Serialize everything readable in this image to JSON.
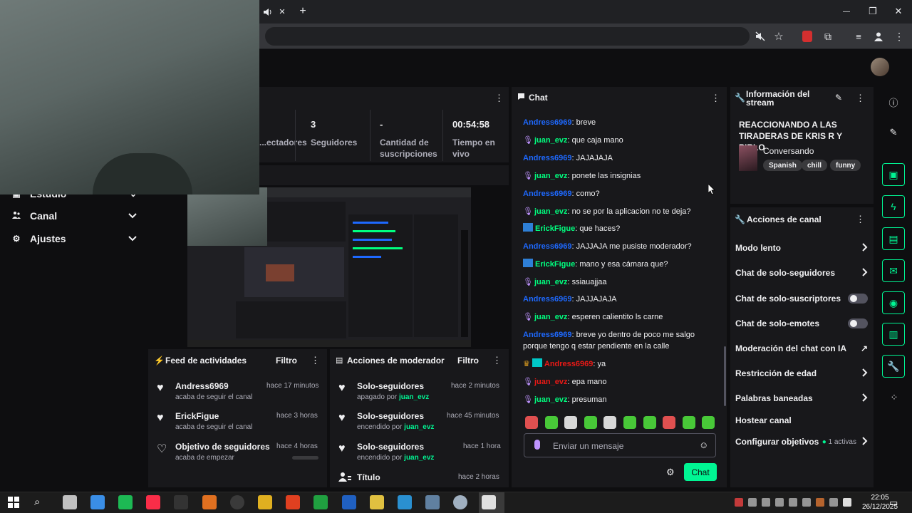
{
  "browser": {
    "minimize": "—",
    "maximize": "❐",
    "close": "✕",
    "new_tab": "+",
    "tab_close": "✕"
  },
  "sidebar": {
    "items": [
      {
        "label": "Estudio"
      },
      {
        "label": "Canal"
      },
      {
        "label": "Ajustes"
      }
    ]
  },
  "stats": {
    "items": [
      {
        "value": "",
        "label": "...ectadores"
      },
      {
        "value": "3",
        "label": "Seguidores"
      },
      {
        "value": "-",
        "label": "Cantidad de suscripciones"
      },
      {
        "value": "00:54:58",
        "label": "Tiempo en vivo"
      }
    ]
  },
  "activity_feed": {
    "title": "Feed de actividades",
    "filter": "Filtro",
    "items": [
      {
        "name": "Andress6969",
        "sub": "acaba de seguir el canal",
        "time": "hace 17 minutos"
      },
      {
        "name": "ErickFigue",
        "sub": "acaba de seguir el canal",
        "time": "hace 3 horas"
      },
      {
        "name": "Objetivo de seguidores",
        "sub": "acaba de empezar",
        "time": "hace 4 horas"
      }
    ]
  },
  "mod_actions": {
    "title": "Acciones de moderador",
    "filter": "Filtro",
    "items": [
      {
        "name": "Solo-seguidores",
        "sub_prefix": "apagado por ",
        "user": "juan_evz",
        "time": "hace 2 minutos"
      },
      {
        "name": "Solo-seguidores",
        "sub_prefix": "encendido por ",
        "user": "juan_evz",
        "time": "hace 45 minutos"
      },
      {
        "name": "Solo-seguidores",
        "sub_prefix": "encendido por ",
        "user": "juan_evz",
        "time": "hace 1 hora"
      },
      {
        "name": "Título",
        "sub_prefix": "",
        "user": "",
        "time": "hace 2 horas"
      }
    ]
  },
  "chat": {
    "title": "Chat",
    "input_placeholder": "Enviar un mensaje",
    "send_label": "Chat",
    "messages": [
      {
        "user": "Andress6969",
        "color": "#1e69ff",
        "badge": "none",
        "text": ": breve"
      },
      {
        "user": "juan_evz",
        "color": "#00ff7f",
        "badge": "mic",
        "text": ": que caja mano"
      },
      {
        "user": "Andress6969",
        "color": "#1e69ff",
        "badge": "none",
        "text": ": JAJAJAJA"
      },
      {
        "user": "juan_evz",
        "color": "#00ff7f",
        "badge": "mic",
        "text": ": ponete las insignias"
      },
      {
        "user": "Andress6969",
        "color": "#1e69ff",
        "badge": "none",
        "text": ": como?"
      },
      {
        "user": "juan_evz",
        "color": "#00ff7f",
        "badge": "mic",
        "text": ": no se por la aplicacion no te deja?"
      },
      {
        "user": "ErickFigue",
        "color": "#00ff7f",
        "badge": "sq",
        "text": ": que haces?"
      },
      {
        "user": "Andress6969",
        "color": "#1e69ff",
        "badge": "none",
        "text": ": JAJJAJA me pusiste moderador?"
      },
      {
        "user": "ErickFigue",
        "color": "#00ff7f",
        "badge": "sq",
        "text": ": mano y esa cámara que?"
      },
      {
        "user": "juan_evz",
        "color": "#00ff7f",
        "badge": "mic",
        "text": ": ssiauajjaa"
      },
      {
        "user": "Andress6969",
        "color": "#1e69ff",
        "badge": "none",
        "text": ": JAJJAJAJA"
      },
      {
        "user": "juan_evz",
        "color": "#00ff7f",
        "badge": "mic",
        "text": ": esperen calientito ls carne"
      },
      {
        "user": "Andress6969",
        "color": "#1e69ff",
        "badge": "none",
        "text": ": breve yo dentro de poco me salgo porque tengo q estar pendiente en la calle"
      },
      {
        "user": "Andress6969",
        "color": "#e91916",
        "badge": "crown",
        "text": ": ya"
      },
      {
        "user": "juan_evz",
        "color": "#e91916",
        "badge": "mic",
        "text": ": epa mano"
      },
      {
        "user": "juan_evz",
        "color": "#00ff7f",
        "badge": "mic",
        "text": ": presuman"
      }
    ],
    "emote_colors": [
      "#e05050",
      "#48c838",
      "#d8d8d8",
      "#48c838",
      "#d8d8d8",
      "#48c838",
      "#48c838",
      "#e05050",
      "#48c838",
      "#48c838"
    ]
  },
  "stream_info": {
    "title": "Información del stream",
    "stream_title": "REACCIONANDO A LAS TIRADERAS DE KRIS R Y PIRLO",
    "category": "Conversando",
    "tags": [
      "Spanish",
      "chill",
      "funny"
    ]
  },
  "channel_actions": {
    "title": "Acciones de canal",
    "items": [
      {
        "label": "Modo lento",
        "control": "chevron"
      },
      {
        "label": "Chat de solo-seguidores",
        "control": "chevron"
      },
      {
        "label": "Chat de solo-suscriptores",
        "control": "toggle"
      },
      {
        "label": "Chat de solo-emotes",
        "control": "toggle"
      },
      {
        "label": "Moderación del chat con IA",
        "control": "external"
      },
      {
        "label": "Restricción de edad",
        "control": "chevron"
      },
      {
        "label": "Palabras baneadas",
        "control": "chevron"
      },
      {
        "label": "Hostear canal",
        "control": "none"
      },
      {
        "label": "Configurar objetivos",
        "control": "chevron"
      }
    ],
    "goals_active": "1 activas"
  },
  "taskbar": {
    "time": "22:05",
    "date": "26/12/2025",
    "icon_colors": [
      "#4a8fe0",
      "#c0c0c0",
      "#3a8ee6",
      "#1db954",
      "#fa2d48",
      "#333333",
      "#e07020",
      "#3a3a3a",
      "#e0b020",
      "#e04020",
      "#20a040",
      "#2060c0",
      "#e0c040",
      "#2a90d0",
      "#6080a0",
      "#a0b0c0",
      "#e0e0e0"
    ]
  }
}
